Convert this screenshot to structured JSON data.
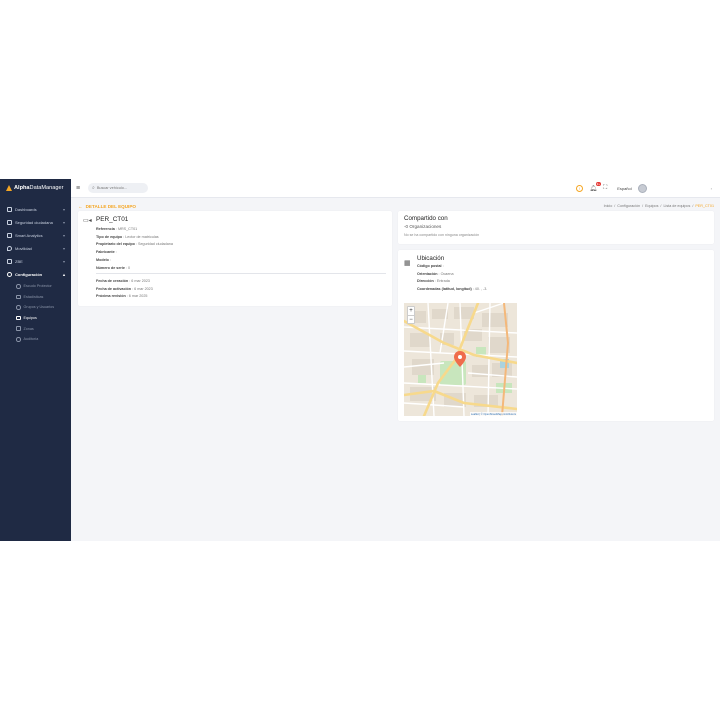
{
  "app": {
    "logo_strong": "Alpha",
    "logo_rest": "DataManager"
  },
  "sidebar": {
    "items": [
      {
        "label": "Dashboards",
        "icon": "dashboard-icon"
      },
      {
        "label": "Seguridad ciudadana",
        "icon": "shield-icon"
      },
      {
        "label": "Smart Analytics",
        "icon": "analytics-icon"
      },
      {
        "label": "Movilidad",
        "icon": "location-pin-icon"
      },
      {
        "label": "ZBE",
        "icon": "zone-icon"
      },
      {
        "label": "Configuración",
        "icon": "gear-icon"
      }
    ],
    "subitems": [
      {
        "label": "Escudo Protector",
        "icon": "shield-outline-icon"
      },
      {
        "label": "Estadísticas",
        "icon": "chart-icon"
      },
      {
        "label": "Grupos y Usuarios",
        "icon": "users-icon"
      },
      {
        "label": "Equipos",
        "icon": "camera-icon"
      },
      {
        "label": "Zonas",
        "icon": "map-icon"
      },
      {
        "label": "Auditoría",
        "icon": "eye-icon"
      }
    ]
  },
  "topbar": {
    "search_placeholder": "Buscar vehículo...",
    "notifications_count": "9+",
    "language": "Español"
  },
  "page": {
    "back_label": "DETALLE DEL EQUIPO",
    "breadcrumbs": [
      "Inicio",
      "Configuración",
      "Equipos",
      "Lista de equipos"
    ],
    "breadcrumb_current": "PER_CT01"
  },
  "device": {
    "title": "PER_CT01",
    "fields": [
      {
        "label": "Referencia",
        "value": "MRS_CT01"
      },
      {
        "label": "Tipo de equipo",
        "value": "Lector de matrículas"
      },
      {
        "label": "Propietario del equipo",
        "value": "Seguridad ciudadana"
      },
      {
        "label": "Fabricante",
        "value": ""
      },
      {
        "label": "Modelo",
        "value": ""
      },
      {
        "label": "Número de serie",
        "value": "0"
      }
    ],
    "dates": [
      {
        "label": "Fecha de creación",
        "value": "6 mar 2023"
      },
      {
        "label": "Fecha de activación",
        "value": "6 mar 2023"
      },
      {
        "label": "Próxima revisión",
        "value": "6 mar 2025"
      }
    ]
  },
  "share": {
    "title": "Compartido con",
    "subtitle": "-0 Organizaciones",
    "note": "No se ha compartido con ninguna organización"
  },
  "location": {
    "title": "Ubicación",
    "fields": [
      {
        "label": "Código postal",
        "value": ""
      },
      {
        "label": "Orientación",
        "value": "Ocaena"
      },
      {
        "label": "Dirección",
        "value": "Entrada"
      },
      {
        "label": "Coordenadas (latitud, longitud)",
        "value": "40.       , -3."
      }
    ],
    "zoom_in": "+",
    "zoom_out": "−",
    "attribution": "Leaflet | © OpenStreetMap contributors"
  },
  "colors": {
    "sidebar_bg": "#1f2a44",
    "accent": "#f5a623",
    "page_bg": "#f4f5f8"
  }
}
